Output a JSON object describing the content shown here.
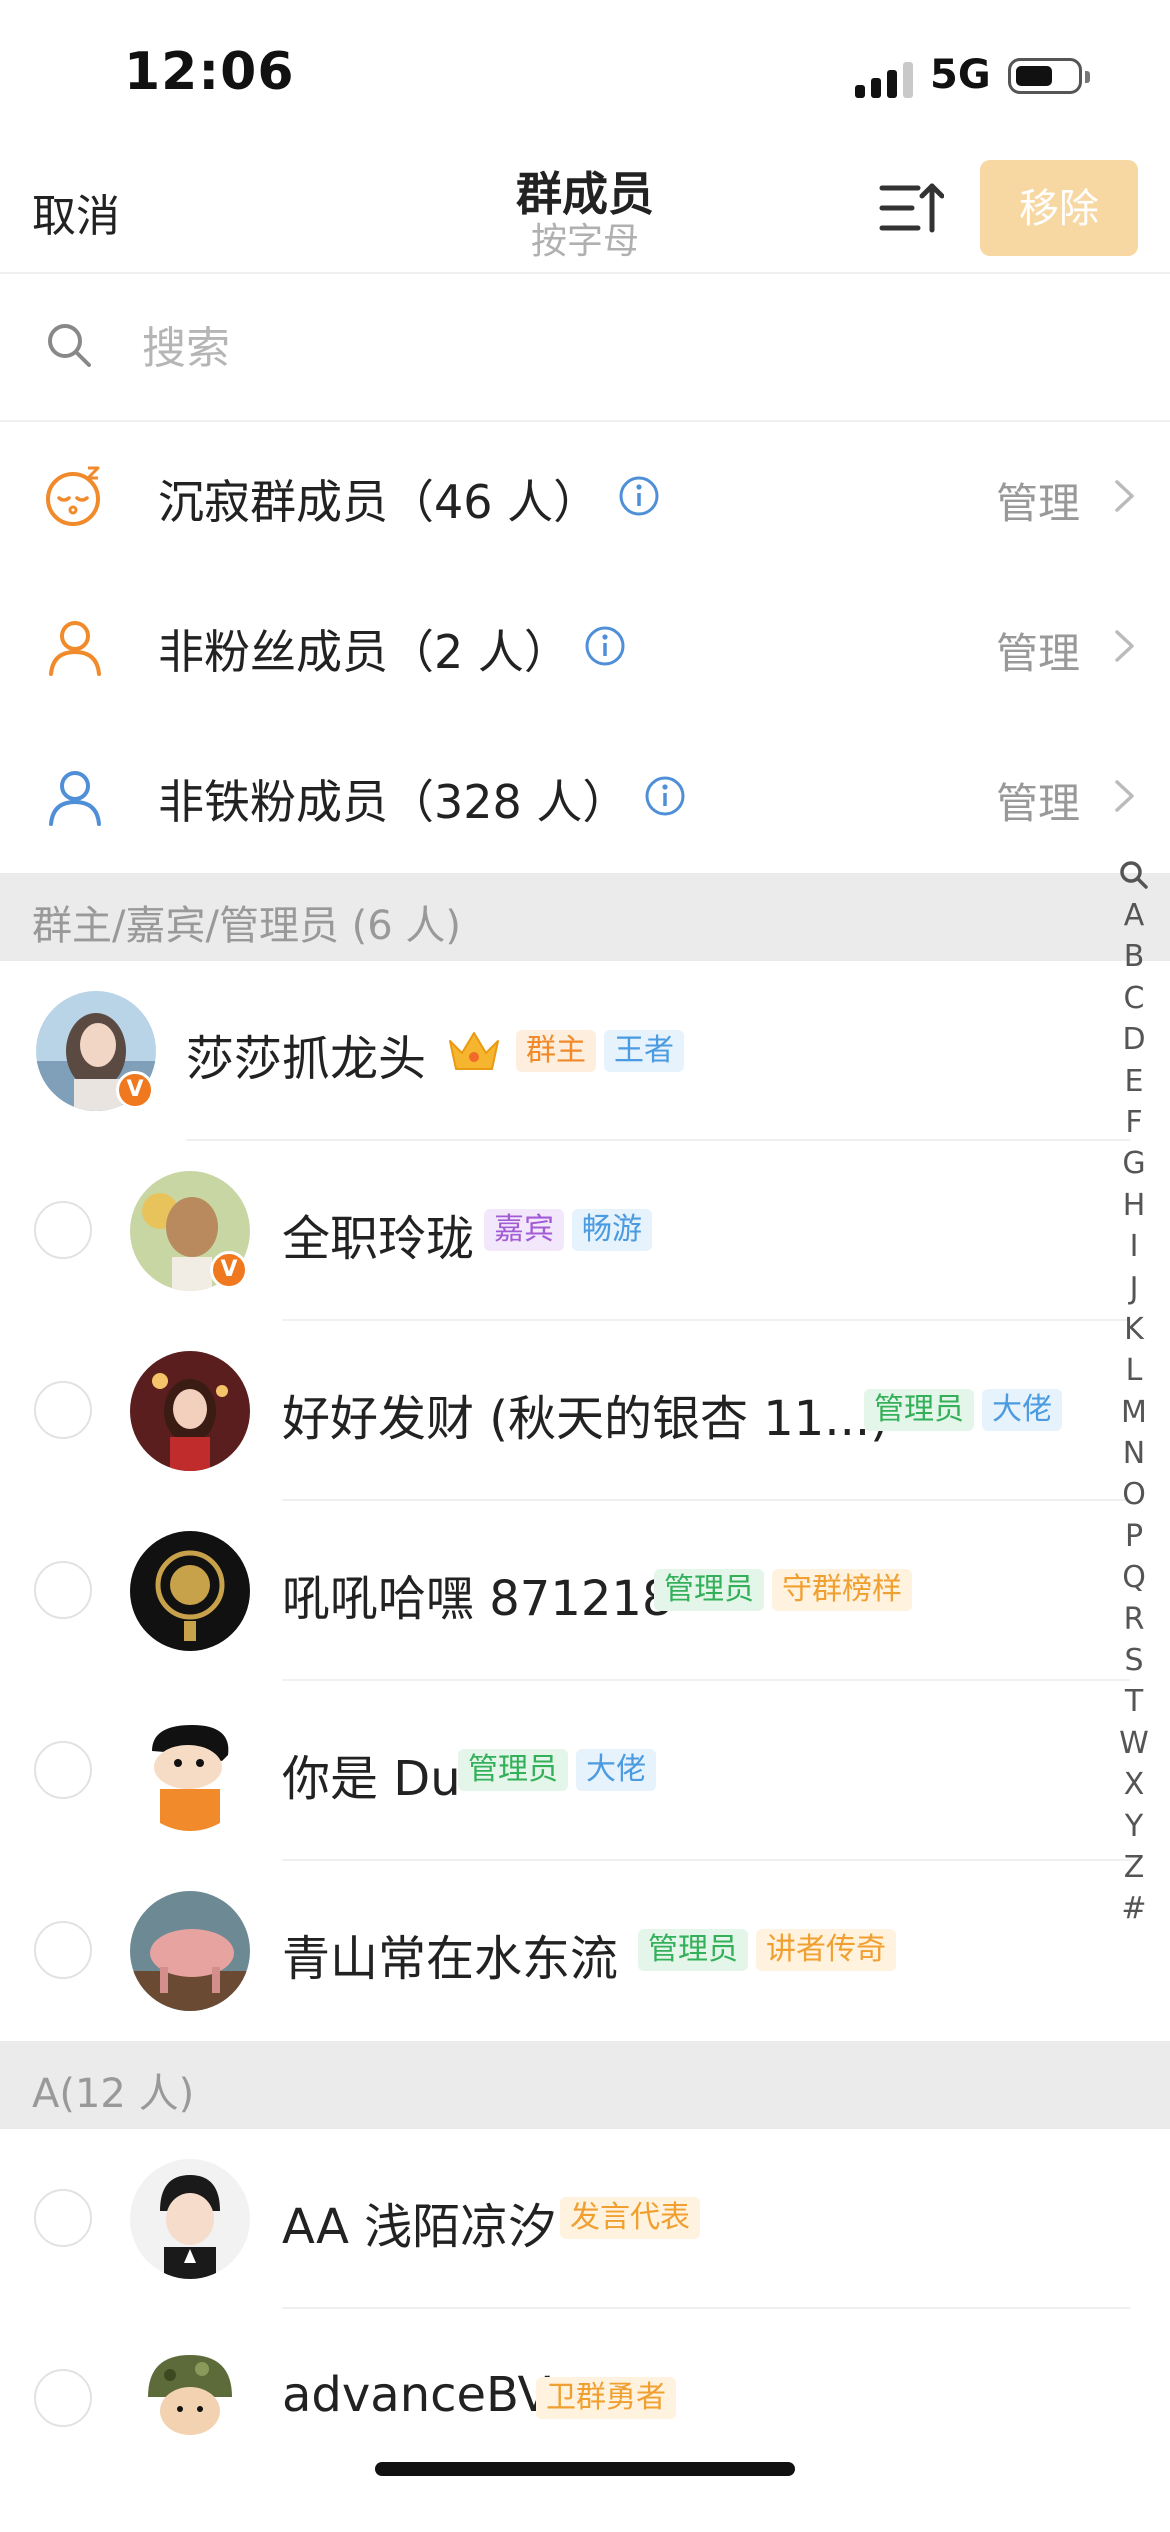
{
  "status_bar": {
    "time": "12:06",
    "network": "5G"
  },
  "nav": {
    "cancel": "取消",
    "title": "群成员",
    "subtitle": "按字母",
    "remove": "移除"
  },
  "search": {
    "placeholder": "搜索"
  },
  "categories": [
    {
      "label": "沉寂群成员（46 人）",
      "manage": "管理",
      "icon": "sleep-face-icon"
    },
    {
      "label": "非粉丝成员（2 人）",
      "manage": "管理",
      "icon": "person-icon"
    },
    {
      "label": "非铁粉成员（328 人）",
      "manage": "管理",
      "icon": "person-icon"
    }
  ],
  "sections": [
    {
      "label": "群主/嘉宾/管理员 (6 人)"
    },
    {
      "label": "A(12 人)"
    }
  ],
  "members": [
    {
      "name": "莎莎抓龙头",
      "tags": [
        "群主",
        "王者"
      ]
    },
    {
      "name": "全职玲珑",
      "tags": [
        "嘉宾",
        "畅游"
      ]
    },
    {
      "name": "好好发财 (秋天的银杏 11...)",
      "tags": [
        "管理员",
        "大佬"
      ]
    },
    {
      "name": "吼吼哈嘿 871218",
      "tags": [
        "管理员",
        "守群榜样"
      ]
    },
    {
      "name": "你是 Du",
      "tags": [
        "管理员",
        "大佬"
      ]
    },
    {
      "name": "青山常在水东流",
      "tags": [
        "管理员",
        "讲者传奇"
      ]
    },
    {
      "name": "AA 浅陌凉汐",
      "tags": [
        "发言代表"
      ]
    },
    {
      "name": "advanceBV",
      "tags": [
        "卫群勇者"
      ]
    }
  ],
  "alphabet": [
    "A",
    "B",
    "C",
    "D",
    "E",
    "F",
    "G",
    "H",
    "I",
    "J",
    "K",
    "L",
    "M",
    "N",
    "O",
    "P",
    "Q",
    "R",
    "S",
    "T",
    "W",
    "X",
    "Y",
    "Z",
    "#"
  ],
  "colors": {
    "accent": "#f08a2b",
    "remove_disabled": "#f7d7a2",
    "section_bg": "#ebebeb"
  }
}
